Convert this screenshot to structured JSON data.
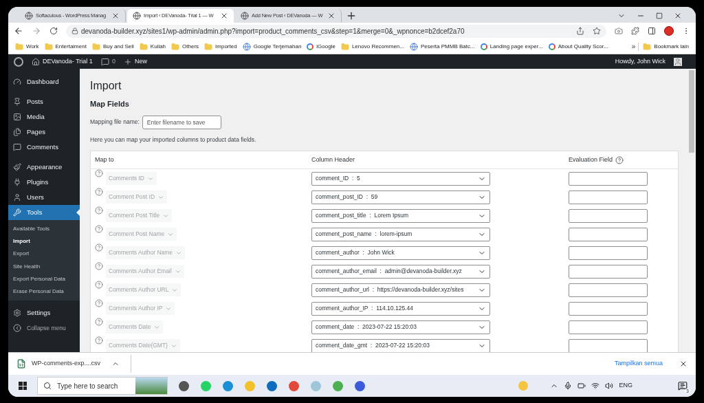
{
  "browser": {
    "tabs": [
      {
        "title": "Softaculous - WordPress Manag",
        "selected": false
      },
      {
        "title": "Import ‹ DEVanoda- Trial 1 — W",
        "selected": true
      },
      {
        "title": "Add New Post ‹ DEVanoda — W",
        "selected": false
      }
    ],
    "url": "devanoda-builder.xyz/sites1/wp-admin/admin.php?import=product_comments_csv&step=1&merge=0&_wpnonce=b2dcef2a70",
    "bookmarks": [
      {
        "label": "Work",
        "kind": "folder"
      },
      {
        "label": "Entertaiment",
        "kind": "folder"
      },
      {
        "label": "Buy and Sell",
        "kind": "folder"
      },
      {
        "label": "Kuliah",
        "kind": "folder"
      },
      {
        "label": "Others",
        "kind": "folder"
      },
      {
        "label": "Imported",
        "kind": "folder"
      },
      {
        "label": "Google Terjemahan",
        "kind": "site"
      },
      {
        "label": "iGoogle",
        "kind": "google"
      },
      {
        "label": "Lenovo Recommen...",
        "kind": "folder"
      },
      {
        "label": "Peserta PMMB Batc...",
        "kind": "site"
      },
      {
        "label": "Landing page exper...",
        "kind": "google"
      },
      {
        "label": "About Quality Scor...",
        "kind": "google"
      }
    ],
    "bookmarks_more": "»",
    "other_bookmarks": "Bookmark lain"
  },
  "admin_bar": {
    "site": "DEVanoda- Trial 1",
    "comments": "0",
    "new": "New",
    "greeting": "Howdy, John Wick"
  },
  "sidebar": {
    "items": [
      {
        "label": "Dashboard",
        "selected": false
      },
      {
        "label": "Posts",
        "selected": false
      },
      {
        "label": "Media",
        "selected": false
      },
      {
        "label": "Pages",
        "selected": false
      },
      {
        "label": "Comments",
        "selected": false
      },
      {
        "label": "Appearance",
        "selected": false
      },
      {
        "label": "Plugins",
        "selected": false
      },
      {
        "label": "Users",
        "selected": false
      },
      {
        "label": "Tools",
        "selected": true,
        "children": [
          {
            "label": "Available Tools",
            "selected": false
          },
          {
            "label": "Import",
            "selected": true
          },
          {
            "label": "Export",
            "selected": false
          },
          {
            "label": "Site Health",
            "selected": false
          },
          {
            "label": "Export Personal Data",
            "selected": false
          },
          {
            "label": "Erase Personal Data",
            "selected": false
          }
        ]
      },
      {
        "label": "Settings",
        "selected": false
      }
    ],
    "collapse": "Collapse menu"
  },
  "page": {
    "title": "Import",
    "section": "Map Fields",
    "mapping_label": "Mapping file name:",
    "mapping_placeholder": "Enter filename to save",
    "description": "Here you can map your imported columns to product data fields.",
    "table": {
      "columns": [
        "Map to",
        "Column Header",
        "Evaluation Field"
      ],
      "rows": [
        {
          "map_to": "Comments ID",
          "column_header": "comment_ID  :  5"
        },
        {
          "map_to": "Comment Post ID",
          "column_header": "comment_post_ID  :  59"
        },
        {
          "map_to": "Comment Post Title",
          "column_header": "comment_post_title  :  Lorem Ipsum"
        },
        {
          "map_to": "Comment Post Name",
          "column_header": "comment_post_name  :  lorem-ipsum"
        },
        {
          "map_to": "Comments Author Name",
          "column_header": "comment_author  :  John Wick"
        },
        {
          "map_to": "Comments Author Email",
          "column_header": "comment_author_email  :  admin@devanoda-builder.xyz"
        },
        {
          "map_to": "Comments Author URL",
          "column_header": "comment_author_url  :  https://devanoda-builder.xyz/sites"
        },
        {
          "map_to": "Comments Author IP",
          "column_header": "comment_author_IP  :  114.10.125.44"
        },
        {
          "map_to": "Comments Date",
          "column_header": "comment_date  :  2023-07-22 15:20:03"
        },
        {
          "map_to": "Comments Date(GMT)",
          "column_header": "comment_date_gmt  :  2023-07-22 15:20:03"
        }
      ]
    }
  },
  "download_bar": {
    "file": "WP-comments-exp....csv",
    "show_all": "Tampilkan semua"
  },
  "taskbar": {
    "search_placeholder": "Type here to search",
    "language": "ENG",
    "notifications": "3"
  }
}
